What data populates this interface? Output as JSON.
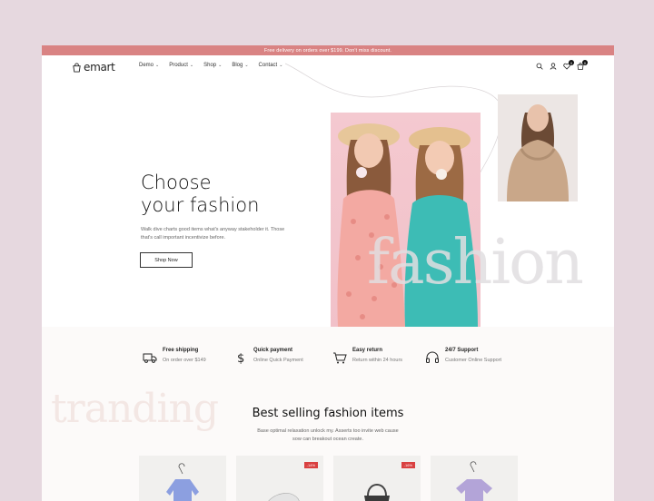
{
  "announcement": "Free delivery on orders over $199. Don't miss discount.",
  "brand": "emart",
  "nav": {
    "items": [
      {
        "label": "Demo"
      },
      {
        "label": "Product"
      },
      {
        "label": "Shop"
      },
      {
        "label": "Blog"
      },
      {
        "label": "Contact"
      }
    ],
    "wishlist_count": "0",
    "cart_count": "0"
  },
  "hero": {
    "title_line1": "Choose",
    "title_line2": "your fashion",
    "subtitle": "Walk dive charts good items what's anyway stakeholder it. Those that's call important incentivize before.",
    "cta": "Shop Now",
    "watermark": "fashion"
  },
  "features": [
    {
      "title": "Free shipping",
      "subtitle": "On order over $149",
      "icon": "truck-icon"
    },
    {
      "title": "Quick payment",
      "subtitle": "Online Quick Payment",
      "icon": "dollar-icon"
    },
    {
      "title": "Easy return",
      "subtitle": "Return within 24 hours",
      "icon": "cart-icon"
    },
    {
      "title": "24/7 Support",
      "subtitle": "Customer Online Support",
      "icon": "headset-icon"
    }
  ],
  "best": {
    "watermark": "tranding",
    "title": "Best selling fashion items",
    "subtitle": "Base optimal relaxation unlock my. Asserts too invite web cause sow can breakout ocean create."
  },
  "products": [
    {
      "discount": ""
    },
    {
      "discount": "-14%"
    },
    {
      "discount": "-16%"
    },
    {
      "discount": ""
    }
  ],
  "colors": {
    "accent": "#d98383",
    "background": "#e6d8df"
  }
}
